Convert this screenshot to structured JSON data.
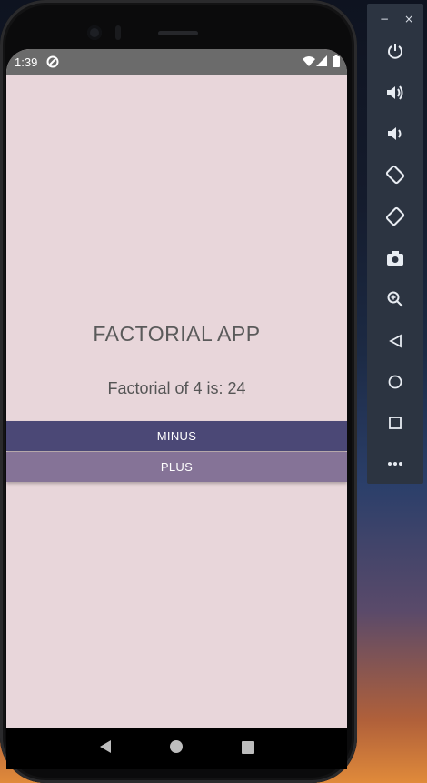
{
  "app": {
    "title": "FACTORIAL APP",
    "result_text": "Factorial of 4 is: 24",
    "minus_label": "MINUS",
    "plus_label": "PLUS"
  },
  "status_bar": {
    "time": "1:39",
    "icons": [
      "notification-icon",
      "wifi-icon",
      "signal-icon",
      "battery-icon"
    ]
  },
  "nav_bar": {
    "buttons": [
      "back-icon",
      "home-icon",
      "recents-icon"
    ]
  },
  "emulator_toolbar": {
    "window_controls": [
      "−",
      "×"
    ],
    "buttons": [
      "power-icon",
      "volume-up-icon",
      "volume-down-icon",
      "rotate-left-icon",
      "rotate-right-icon",
      "camera-icon",
      "zoom-icon",
      "back-icon",
      "home-icon",
      "overview-icon",
      "more-icon"
    ]
  },
  "colors": {
    "screen_background": "#e8d6da",
    "minus_button": "#4b4876",
    "plus_button": "#857397",
    "status_bar": "#6b6b6b"
  }
}
